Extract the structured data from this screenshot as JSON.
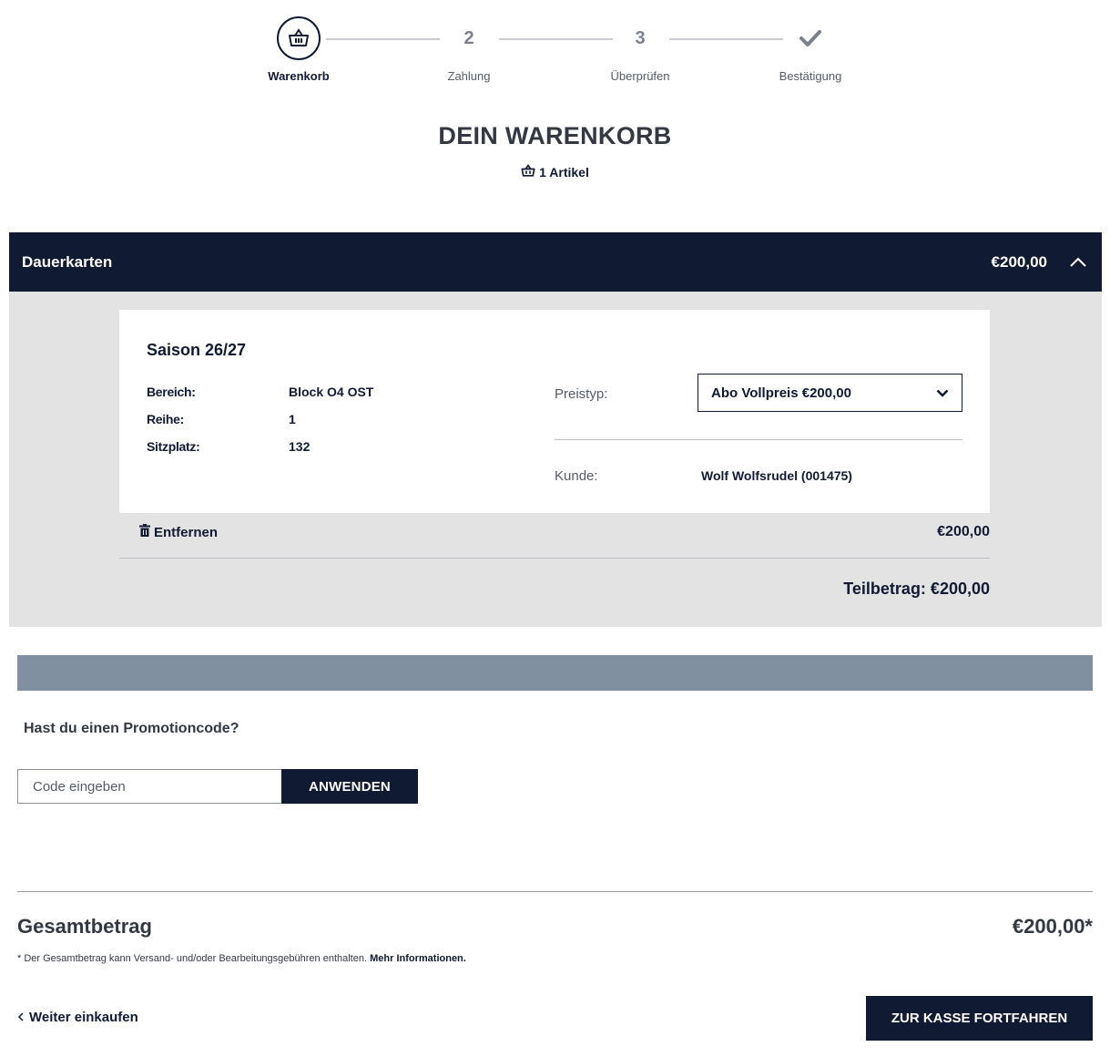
{
  "stepper": {
    "steps": [
      {
        "number": "",
        "icon": "basket-icon",
        "label": "Warenkorb",
        "active": true
      },
      {
        "number": "2",
        "label": "Zahlung",
        "active": false
      },
      {
        "number": "3",
        "label": "Überprüfen",
        "active": false
      },
      {
        "number": "",
        "icon": "check-icon",
        "label": "Bestätigung",
        "active": false
      }
    ]
  },
  "header": {
    "title": "DEIN WARENKORB",
    "item_count": "1 Artikel"
  },
  "section": {
    "name": "Dauerkarten",
    "amount": "€200,00",
    "card": {
      "season": "Saison 26/27",
      "rows": [
        {
          "key": "Bereich:",
          "value": "Block O4 OST"
        },
        {
          "key": "Reihe:",
          "value": "1"
        },
        {
          "key": "Sitzplatz:",
          "value": "132"
        }
      ],
      "price_type_label": "Preistyp:",
      "price_type_value": "Abo Vollpreis €200,00",
      "customer_label": "Kunde:",
      "customer_value": "Wolf Wolfsrudel (001475)"
    },
    "remove_label": "Entfernen",
    "line_price": "€200,00",
    "subtotal": "Teilbetrag: €200,00"
  },
  "promo": {
    "question": "Hast du einen Promotioncode?",
    "placeholder": "Code eingeben",
    "apply_label": "ANWENDEN"
  },
  "total": {
    "label": "Gesamtbetrag",
    "value": "€200,00*",
    "note": "* Der Gesamtbetrag kann Versand- und/oder Bearbeitungsgebühren enthalten.",
    "note_link": "Mehr Informationen."
  },
  "footer": {
    "continue_label": "Weiter einkaufen",
    "checkout_label": "ZUR KASSE FORTFAHREN"
  },
  "colors": {
    "navy": "#111a33",
    "section_bg": "#e3e3e3",
    "promo_bar": "#8090a0"
  }
}
